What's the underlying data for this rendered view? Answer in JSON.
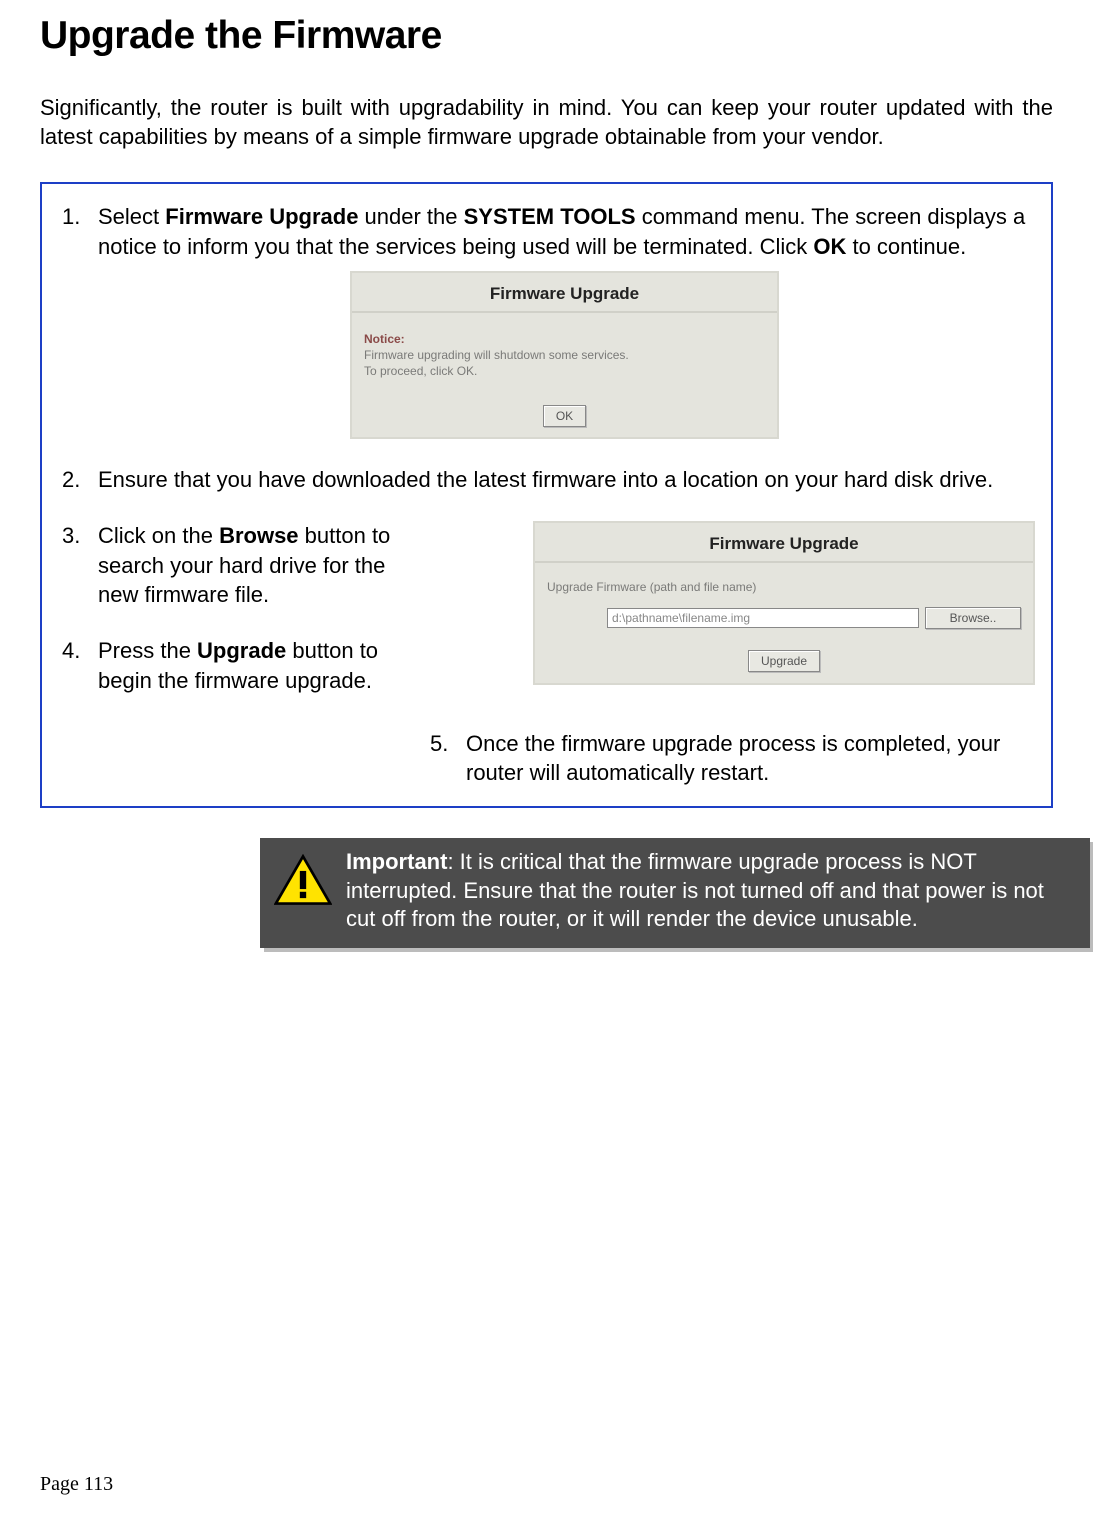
{
  "heading": "Upgrade the Firmware",
  "intro": "Significantly, the router is built with upgradability in mind. You can keep your router updated with the latest capabilities by means of a simple firmware upgrade obtainable from your vendor.",
  "steps": {
    "s1_a": "Select ",
    "s1_b": "Firmware Upgrade",
    "s1_c": " under the ",
    "s1_d": "SYSTEM TOOLS",
    "s1_e": " command menu. The screen displays a notice to inform you that the services being used will be terminated. Click ",
    "s1_f": "OK",
    "s1_g": " to continue.",
    "s2": "Ensure that you have downloaded the latest firmware into a location on your hard disk drive.",
    "s3_a": "Click on the ",
    "s3_b": "Browse",
    "s3_c": " button to search your hard drive for the new firmware file.",
    "s4_a": "Press the ",
    "s4_b": "Upgrade",
    "s4_c": " button to begin the firmware upgrade.",
    "s5": "Once the firmware upgrade process is completed, your router will automatically restart.",
    "s5_num": "5."
  },
  "dialog1": {
    "title": "Firmware Upgrade",
    "notice_label": "Notice:",
    "line1": "Firmware upgrading will shutdown some services.",
    "line2": "To proceed, click OK.",
    "ok": "OK"
  },
  "dialog2": {
    "title": "Firmware Upgrade",
    "label": "Upgrade Firmware (path and file name)",
    "path": "d:\\pathname\\filename.img",
    "browse": "Browse..",
    "upgrade": "Upgrade"
  },
  "important": {
    "label": "Important",
    "text": ": It is critical that the firmware upgrade process is NOT interrupted. Ensure that the router is not turned off and that power is not cut off from the router, or it will render the device unusable."
  },
  "page_number": "Page 113"
}
